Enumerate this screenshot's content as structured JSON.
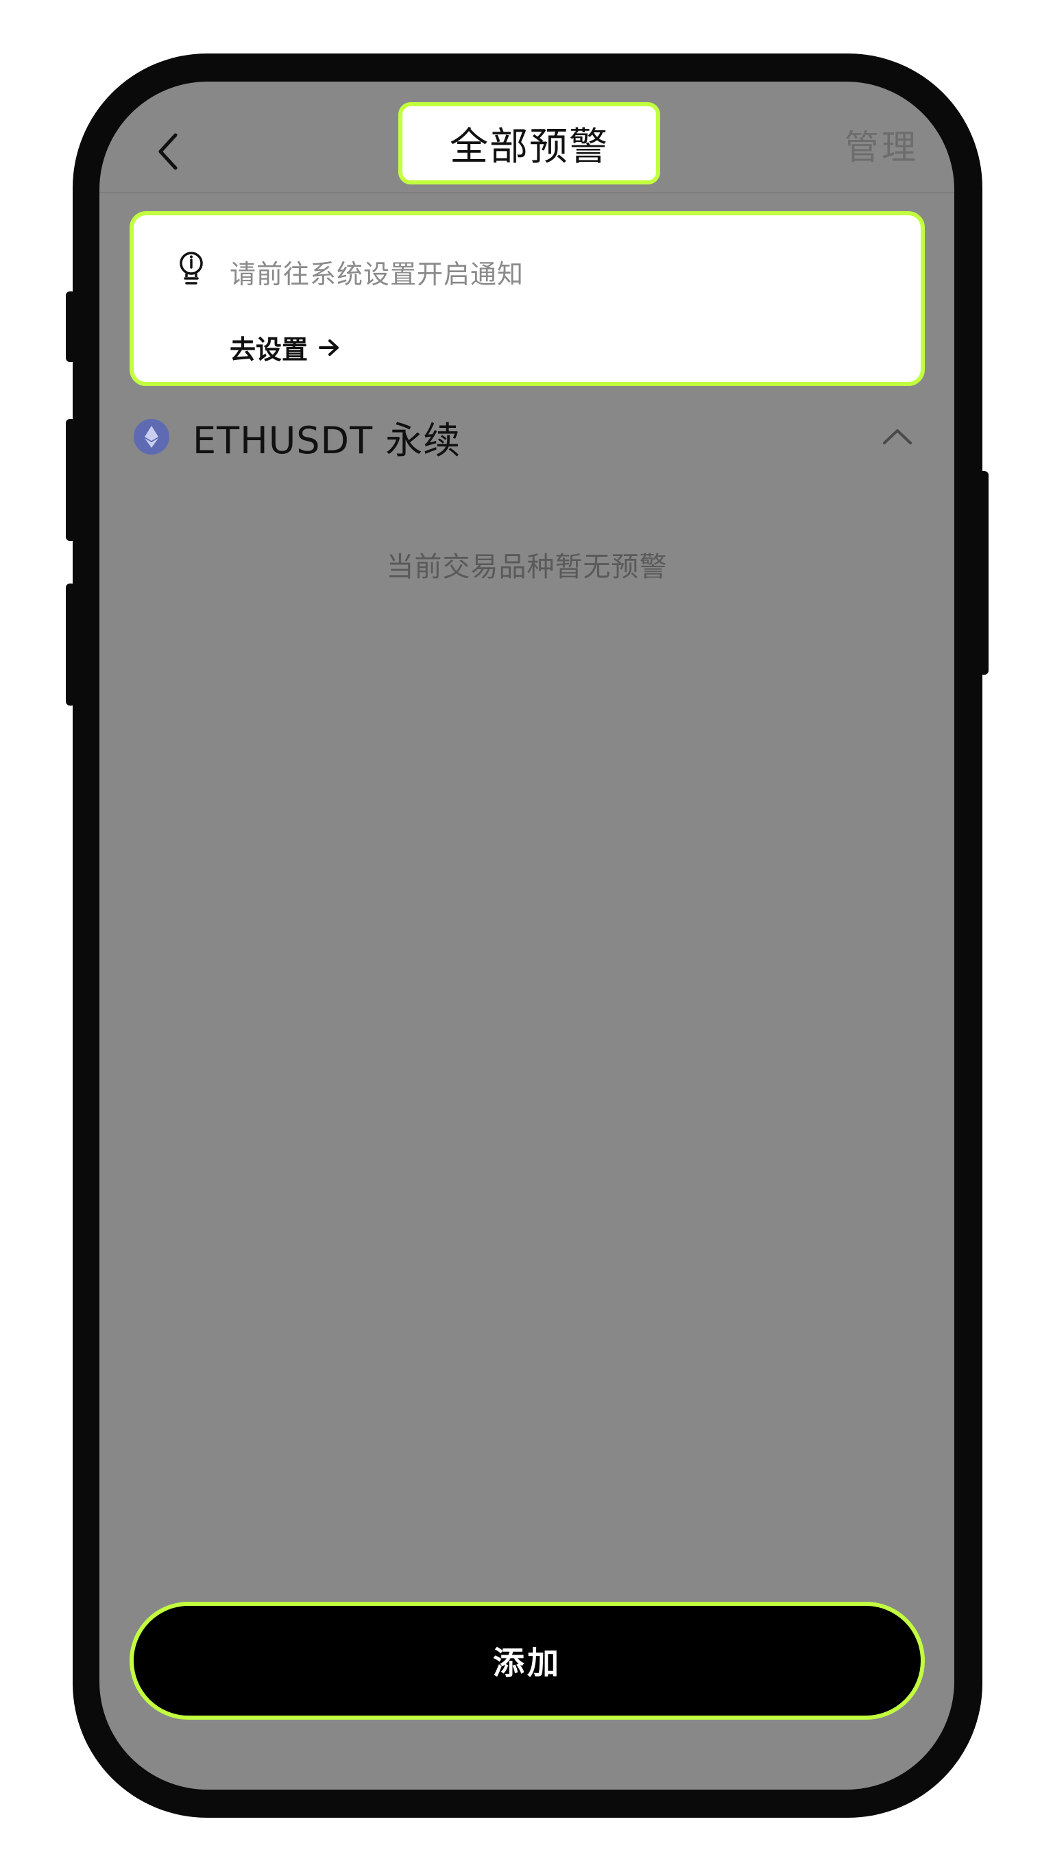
{
  "nav": {
    "title": "全部预警",
    "manage_label": "管理",
    "back_icon": "chevron-left-icon"
  },
  "notice": {
    "icon": "lightbulb-icon",
    "text": "请前往系统设置开启通知",
    "link_label": "去设置",
    "link_icon": "arrow-right-icon"
  },
  "instrument": {
    "icon": "ethereum-icon",
    "name": "ETHUSDT 永续",
    "toggle_icon": "chevron-up-icon",
    "empty_message": "当前交易品种暂无预警"
  },
  "footer": {
    "add_label": "添加"
  },
  "colors": {
    "highlight": "#c2ff3f",
    "overlay": "#888888",
    "eth": "#5e6bb3",
    "button": "#000000"
  }
}
